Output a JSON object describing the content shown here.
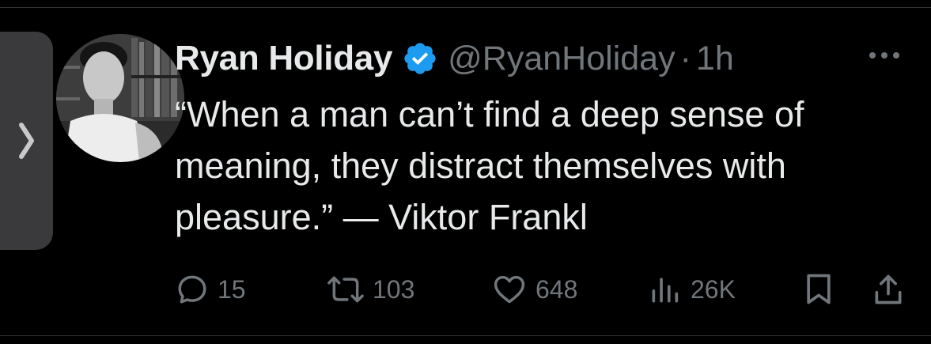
{
  "tweet": {
    "author_name": "Ryan Holiday",
    "handle": "@RyanHoliday",
    "separator": "·",
    "time": "1h",
    "text": "“When a man can’t find a deep sense of meaning, they distract themselves with pleasure.” — Viktor Frankl",
    "verified": true
  },
  "actions": {
    "replies": "15",
    "retweets": "103",
    "likes": "648",
    "views": "26K"
  },
  "icons": {
    "side_handle": "chevron-right-icon",
    "verified": "verified-badge-icon",
    "more": "more-dots-icon",
    "reply": "reply-icon",
    "retweet": "retweet-icon",
    "like": "heart-icon",
    "views": "views-bar-chart-icon",
    "bookmark": "bookmark-icon",
    "share": "share-icon"
  },
  "colors": {
    "background": "#000000",
    "text_primary": "#e7e9ea",
    "text_secondary": "#71767b",
    "verified_blue": "#1d9bf0",
    "side_handle": "#3a3a3c"
  }
}
